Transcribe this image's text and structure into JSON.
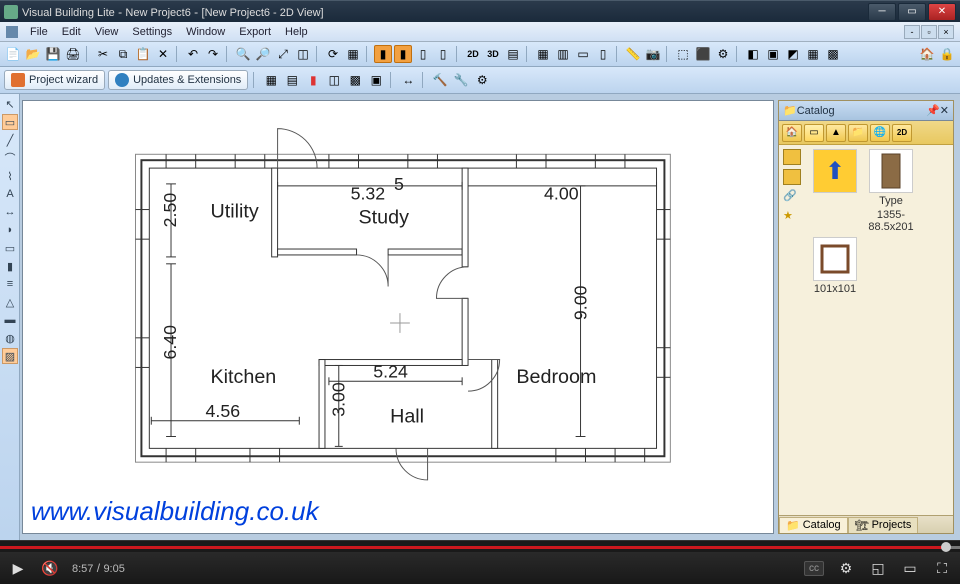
{
  "titlebar": {
    "app": "Visual Building Lite",
    "doc": "New Project6",
    "view": "[New Project6 - 2D View]"
  },
  "menu": [
    "File",
    "Edit",
    "View",
    "Settings",
    "Window",
    "Export",
    "Help"
  ],
  "toolbar2": {
    "wizard": "Project wizard",
    "updates": "Updates & Extensions"
  },
  "plan": {
    "rooms": {
      "utility": "Utility",
      "study": "Study",
      "kitchen": "Kitchen",
      "bedroom": "Bedroom",
      "hall": "Hall"
    },
    "dims": {
      "d250": "2.50",
      "d532": "5.32",
      "d5": "5",
      "d400": "4.00",
      "d640": "6.40",
      "d900": "9.00",
      "d456": "4.56",
      "d524": "5.24",
      "d300": "3.00"
    }
  },
  "watermark": "www.visualbuilding.co.uk",
  "catalog": {
    "title": "Catalog",
    "tabs": {
      "catalog": "Catalog",
      "projects": "Projects"
    },
    "items": {
      "type": "Type",
      "typedim": "1355-88.5x201",
      "door": "101x101"
    }
  },
  "video": {
    "current": "8:57",
    "total": "9:05",
    "cc": "cc"
  }
}
